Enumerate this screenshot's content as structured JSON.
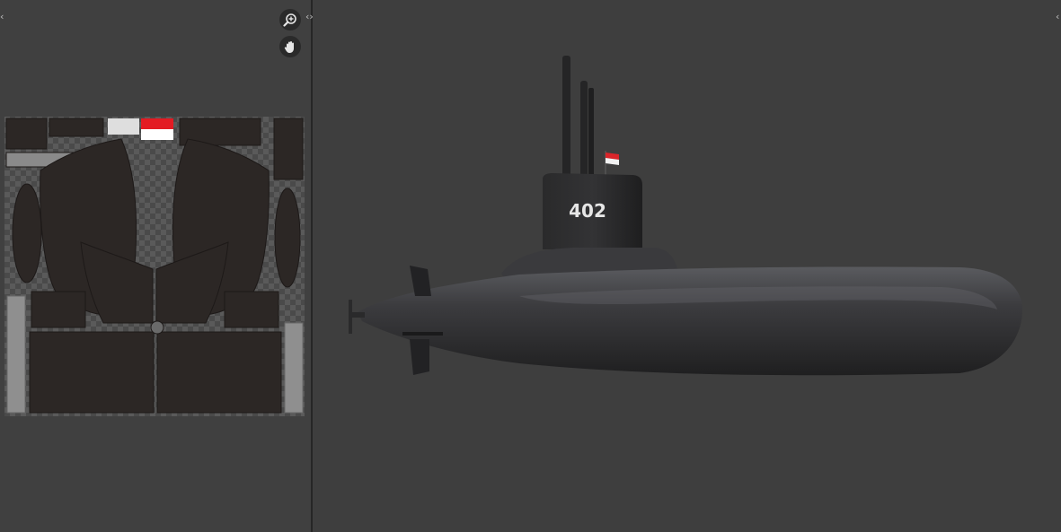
{
  "uv_editor": {
    "tools": {
      "zoom_icon": "zoom-in-icon",
      "pan_icon": "hand-icon"
    },
    "collapse_left_glyph": "‹",
    "expand_glyph": "‹›",
    "texture": {
      "flag_colors": [
        "#e31b23",
        "#ffffff"
      ],
      "hull_color": "#2c2725"
    }
  },
  "viewport": {
    "expand_right_glyph": "‹",
    "model": {
      "hull_number": "402",
      "flag_colors": [
        "#d9252a",
        "#f2f2f2"
      ],
      "hull_color": "#2f2f31"
    }
  }
}
